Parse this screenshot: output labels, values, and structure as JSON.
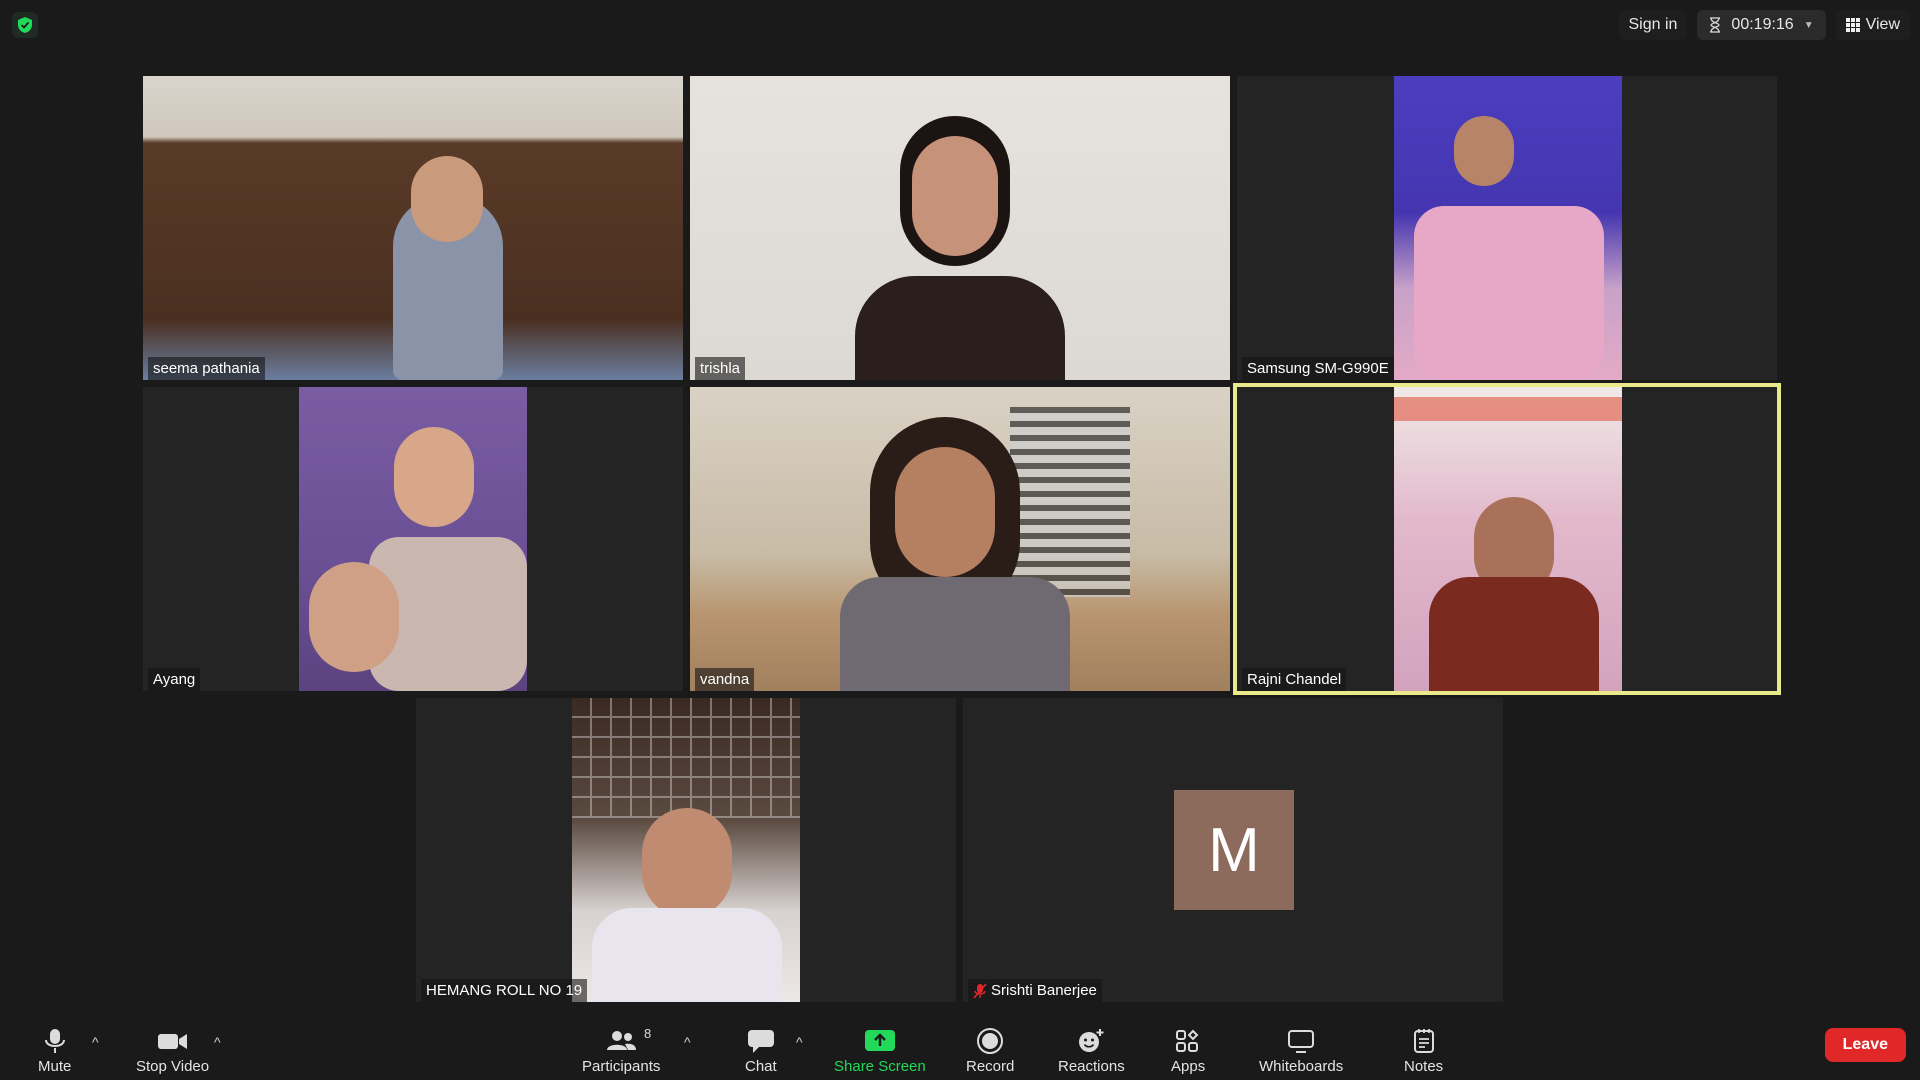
{
  "window": {
    "title": "Zoom Meeting"
  },
  "topbar": {
    "sign_in": "Sign in",
    "timer": "00:19:16",
    "view": "View"
  },
  "participants": [
    {
      "name": "seema pathania"
    },
    {
      "name": "trishla"
    },
    {
      "name": "Samsung SM-G990E"
    },
    {
      "name": "Ayang"
    },
    {
      "name": "vandna"
    },
    {
      "name": "Rajni Chandel"
    },
    {
      "name": "HEMANG ROLL NO 19"
    },
    {
      "name": "Srishti Banerjee",
      "avatar_letter": "M",
      "muted": true
    }
  ],
  "toolbar": {
    "mute": "Mute",
    "stop_video": "Stop Video",
    "participants": "Participants",
    "participants_count": "8",
    "chat": "Chat",
    "share_screen": "Share Screen",
    "record": "Record",
    "reactions": "Reactions",
    "apps": "Apps",
    "whiteboards": "Whiteboards",
    "notes": "Notes",
    "leave": "Leave"
  },
  "colors": {
    "background": "#1a1a1a",
    "tile": "#242424",
    "active_speaker_border": "#eaea8a",
    "share_screen_green": "#23d959",
    "leave_red": "#e02828",
    "avatar_bg": "#8c6a5c",
    "security_green": "#23d959"
  }
}
